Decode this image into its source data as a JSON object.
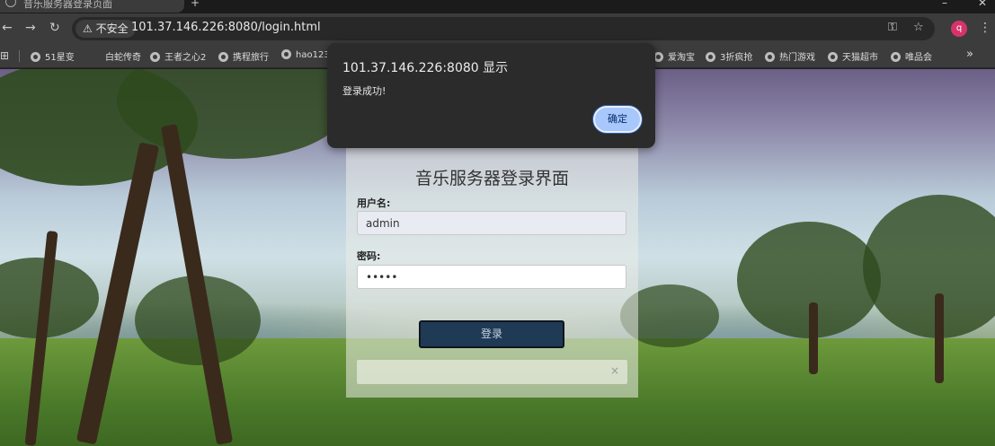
{
  "browser": {
    "tab_title": "音乐服务器登录页面",
    "insecure_label": "不安全",
    "url": "101.37.146.226:8080/login.html",
    "profile_initial": "q",
    "bookmarks": [
      "51星变",
      "白蛇传奇",
      "王者之心2",
      "携程旅行",
      "hao123",
      "爱淘宝",
      "3折疯抢",
      "热门游戏",
      "天猫超市",
      "唯品会"
    ]
  },
  "login": {
    "title": "音乐服务器登录界面",
    "username_label": "用户名:",
    "username_value": "admin",
    "password_label": "密码:",
    "password_value": "•••••",
    "submit_label": "登录",
    "close_symbol": "×"
  },
  "dialog": {
    "title": "101.37.146.226:8080 显示",
    "message": "登录成功!",
    "ok_label": "确定"
  }
}
